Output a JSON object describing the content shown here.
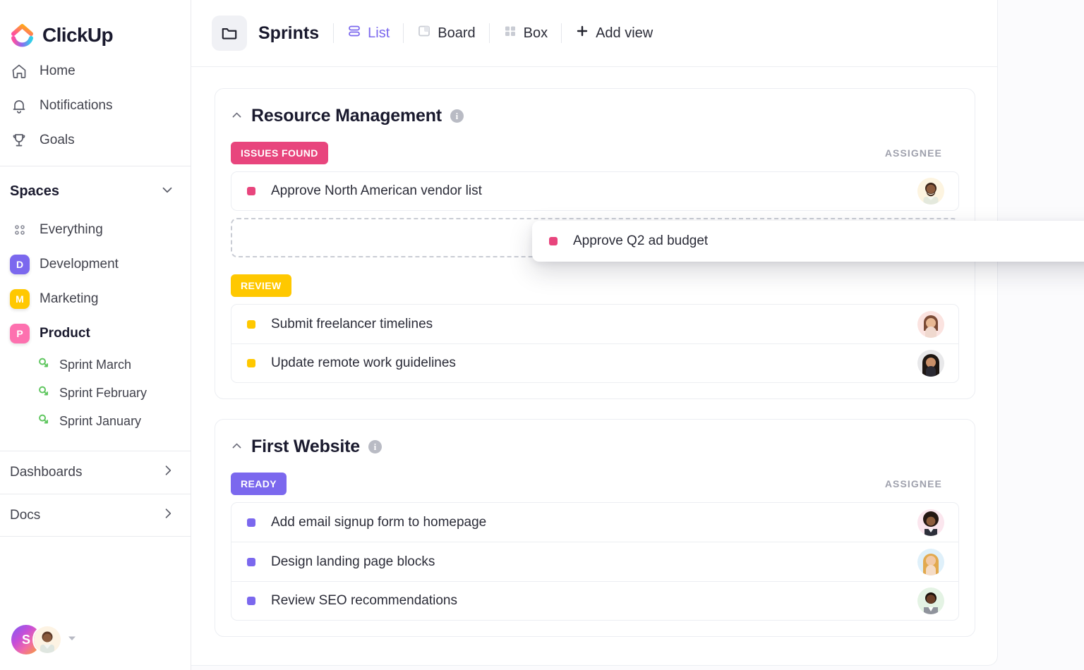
{
  "brand": {
    "name": "ClickUp",
    "accent": "#7b68ee"
  },
  "sidebar": {
    "nav": [
      {
        "label": "Home",
        "icon": "home-icon"
      },
      {
        "label": "Notifications",
        "icon": "bell-icon"
      },
      {
        "label": "Goals",
        "icon": "trophy-icon"
      }
    ],
    "spaces_title": "Spaces",
    "everything_label": "Everything",
    "spaces": [
      {
        "label": "Development",
        "initial": "D",
        "color": "#7b68ee",
        "active": false
      },
      {
        "label": "Marketing",
        "initial": "M",
        "color": "#ffc800",
        "active": false
      },
      {
        "label": "Product",
        "initial": "P",
        "color": "#fd71af",
        "active": true
      }
    ],
    "sprints": [
      {
        "label": "Sprint  March"
      },
      {
        "label": "Sprint  February"
      },
      {
        "label": "Sprint January"
      }
    ],
    "sections": [
      {
        "label": "Dashboards"
      },
      {
        "label": "Docs"
      }
    ],
    "workspace_initial": "S"
  },
  "topbar": {
    "folder_icon": "folder-icon",
    "title": "Sprints",
    "views": [
      {
        "label": "List",
        "icon": "list-icon",
        "active": true
      },
      {
        "label": "Board",
        "icon": "board-icon",
        "active": false
      },
      {
        "label": "Box",
        "icon": "box-icon",
        "active": false
      }
    ],
    "add_view_label": "Add view"
  },
  "assignee_header": "ASSIGNEE",
  "groups": [
    {
      "title": "Resource Management",
      "statuses": [
        {
          "label": "ISSUES FOUND",
          "color": "#e8457d",
          "show_assignee_header": true,
          "tasks": [
            {
              "name": "Approve North American vendor list",
              "dot": "#e8457d",
              "avatar": "avatar-man-beard"
            }
          ],
          "has_drop_placeholder": true
        },
        {
          "label": "REVIEW",
          "color": "#ffc800",
          "show_assignee_header": false,
          "tasks": [
            {
              "name": "Submit freelancer timelines",
              "dot": "#ffc800",
              "avatar": "avatar-woman-smiling"
            },
            {
              "name": "Update remote work guidelines",
              "dot": "#ffc800",
              "avatar": "avatar-woman-dark-hair"
            }
          ],
          "has_drop_placeholder": false
        }
      ]
    },
    {
      "title": "First Website",
      "statuses": [
        {
          "label": "READY",
          "color": "#7b68ee",
          "show_assignee_header": true,
          "tasks": [
            {
              "name": "Add email signup form to homepage",
              "dot": "#7b68ee",
              "avatar": "avatar-man-afro"
            },
            {
              "name": "Design landing page blocks",
              "dot": "#7b68ee",
              "avatar": "avatar-woman-blonde"
            },
            {
              "name": "Review SEO recommendations",
              "dot": "#7b68ee",
              "avatar": "avatar-man-suit"
            }
          ],
          "has_drop_placeholder": false
        }
      ]
    }
  ],
  "drag": {
    "task_name": "Approve Q2 ad budget",
    "dot": "#e8457d",
    "avatar": "avatar-man-short-hair",
    "cursor_icon": "move-cursor-icon"
  }
}
